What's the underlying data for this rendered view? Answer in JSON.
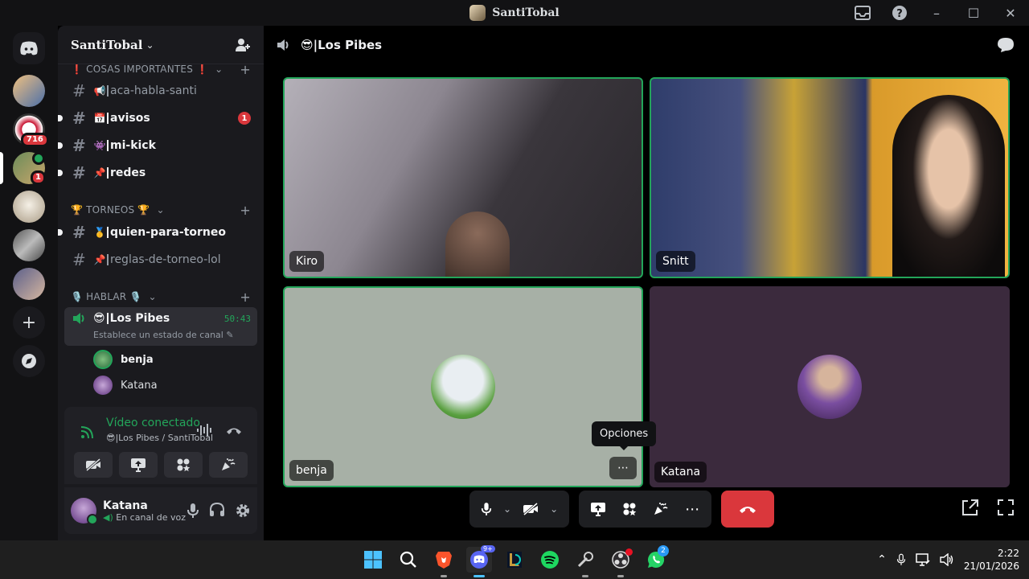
{
  "window": {
    "title": "SantiTobal"
  },
  "guild_badges": {
    "g2": "716",
    "g3": "1"
  },
  "server": {
    "name": "SantiTobal"
  },
  "categories": {
    "important": "❗ COSAS IMPORTANTES ❗",
    "torneos": "🏆 TORNEOS 🏆",
    "hablar": "🎙️ HABLAR 🎙️"
  },
  "channels": [
    {
      "emoji": "📢",
      "name": "aca-habla-santi",
      "unread": false
    },
    {
      "emoji": "📅",
      "name": "avisos",
      "unread": true,
      "mentions": "1"
    },
    {
      "emoji": "👾",
      "name": "mi-kick",
      "unread": true
    },
    {
      "emoji": "📌",
      "name": "redes",
      "unread": true
    },
    {
      "emoji": "🥇",
      "name": "quien-para-torneo",
      "unread": true
    },
    {
      "emoji": "📌",
      "name": "reglas-de-torneo-lol",
      "unread": false
    }
  ],
  "voice_channel": {
    "emoji": "😎",
    "name": "Los Pibes",
    "timer": "50:43",
    "status_placeholder": "Establece un estado de canal"
  },
  "voice_users": [
    "benja",
    "Katana"
  ],
  "rtc": {
    "status": "Vídeo conectado",
    "location": "😎|Los Pibes / SantiTobal"
  },
  "user": {
    "name": "Katana",
    "status": "En canal de voz"
  },
  "main": {
    "channel_title": "😎|Los Pibes"
  },
  "tiles": [
    {
      "name": "Kiro",
      "speaking": true,
      "video": true
    },
    {
      "name": "Snitt",
      "speaking": true,
      "video": true
    },
    {
      "name": "benja",
      "speaking": true,
      "video": false
    },
    {
      "name": "Katana",
      "speaking": false,
      "video": false
    }
  ],
  "tooltip": "Opciones",
  "taskbar": {
    "time": "2:22",
    "date": "21/01/2026",
    "discord_badge": "9+",
    "whatsapp_badge": "2"
  },
  "colors": {
    "green": "#23a55a",
    "red": "#da373c",
    "blurple": "#5865f2"
  }
}
